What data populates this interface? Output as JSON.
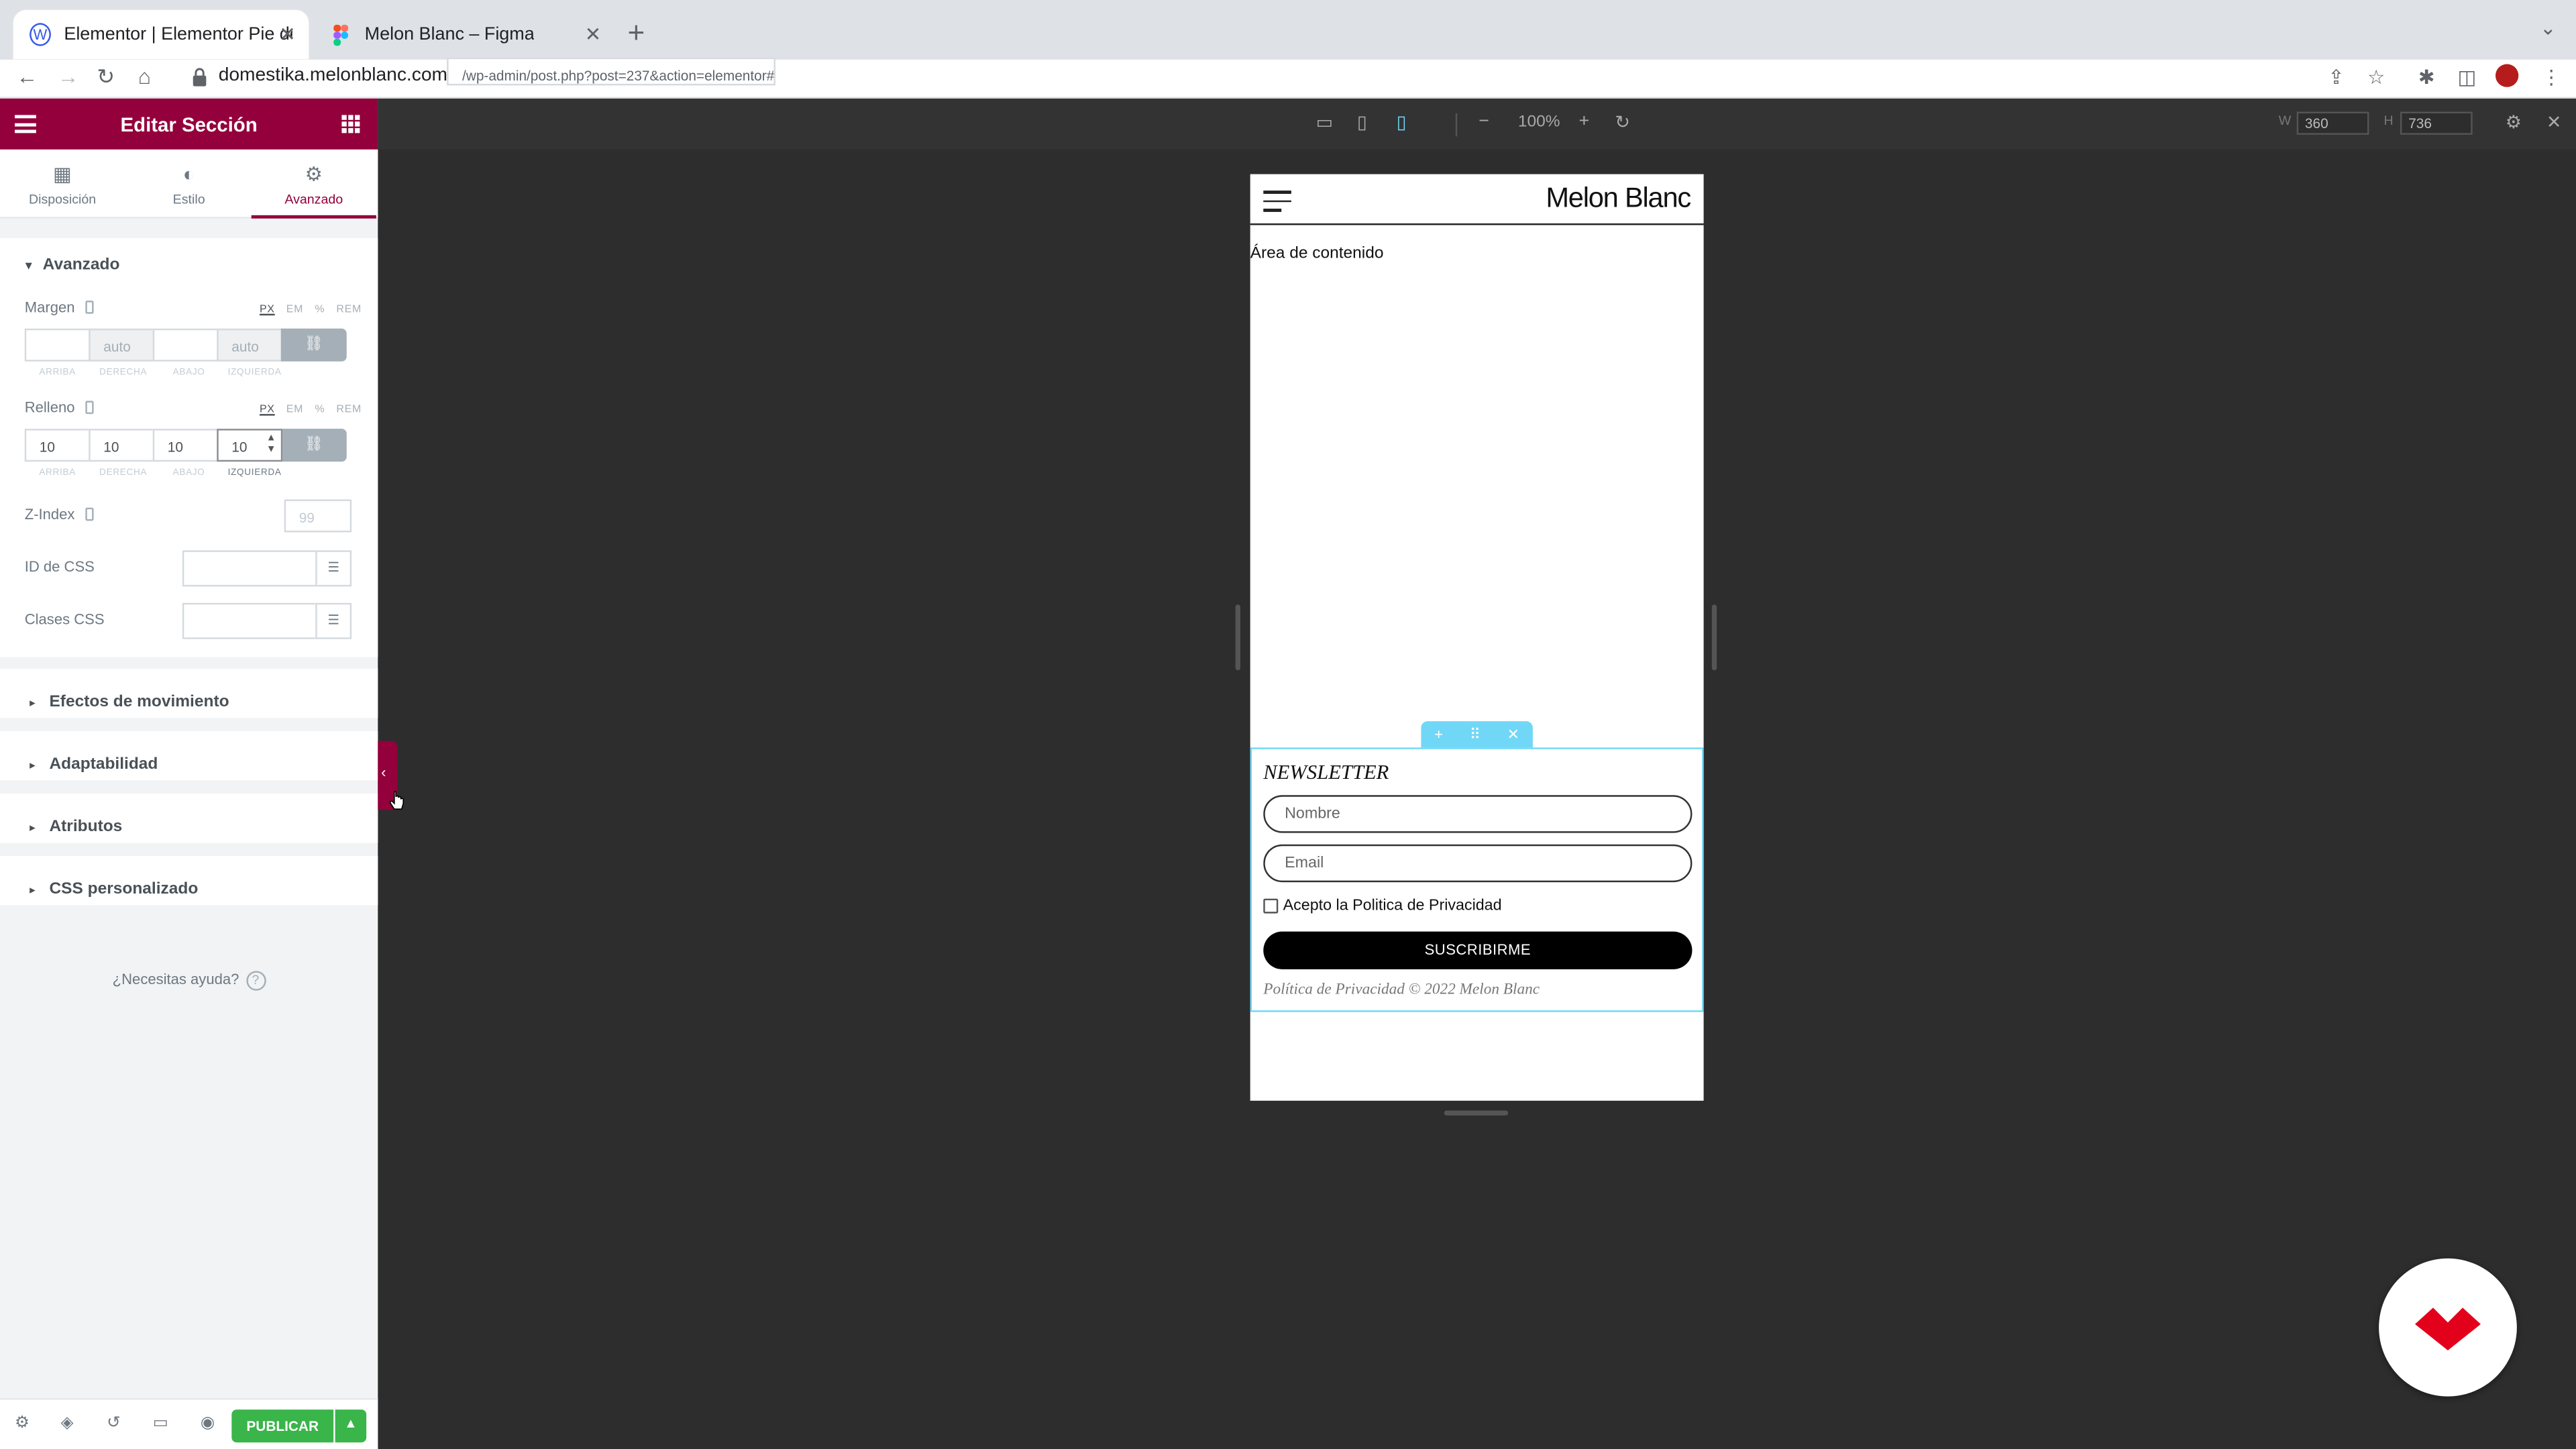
{
  "browser": {
    "tabs": [
      {
        "title": "Elementor | Elementor Pie de p",
        "active": true,
        "favicon": "wordpress-icon"
      },
      {
        "title": "Melon Blanc – Figma",
        "active": false,
        "favicon": "figma-icon"
      }
    ],
    "url_host": "domestika.melonblanc.com",
    "url_path": "/wp-admin/post.php?post=237&action=elementor#"
  },
  "panel": {
    "title": "Editar Sección",
    "tabs": [
      {
        "label": "Disposición",
        "icon": "layout-icon"
      },
      {
        "label": "Estilo",
        "icon": "style-icon"
      },
      {
        "label": "Avanzado",
        "icon": "gear-icon"
      }
    ],
    "active_tab": "Avanzado",
    "section_title": "Avanzado",
    "units": [
      "PX",
      "EM",
      "%",
      "REM"
    ],
    "margin": {
      "label": "Margen",
      "values": [
        "",
        "",
        "",
        ""
      ],
      "placeholders": [
        "",
        "auto",
        "",
        "auto"
      ]
    },
    "padding": {
      "label": "Relleno",
      "values": [
        "10",
        "10",
        "10",
        "10"
      ]
    },
    "side_labels": [
      "ARRIBA",
      "DERECHA",
      "ABAJO",
      "IZQUIERDA"
    ],
    "zindex": {
      "label": "Z-Index",
      "placeholder": "99"
    },
    "css_id_label": "ID de CSS",
    "css_classes_label": "Clases CSS",
    "collapsed_sections": [
      "Efectos de movimiento",
      "Adaptabilidad",
      "Atributos",
      "CSS personalizado"
    ],
    "help_text": "¿Necesitas ayuda?",
    "publish_label": "PUBLICAR"
  },
  "canvas": {
    "zoom": "100%",
    "width_label": "W",
    "width_value": "360",
    "height_label": "H",
    "height_value": "736"
  },
  "preview": {
    "brand": "Melon Blanc",
    "content_area": "Área de contenido",
    "newsletter_title": "NEWSLETTER",
    "name_placeholder": "Nombre",
    "email_placeholder": "Email",
    "checkbox_label": "Acepto la Politica de Privacidad",
    "subscribe_label": "SUSCRIBIRME",
    "footer_text": "Política de Privacidad © 2022 Melon Blanc"
  },
  "colors": {
    "elementor_brand": "#93003c",
    "publish_green": "#39b54a",
    "section_outline": "#71d7f7",
    "domestika_red": "#e3001b"
  }
}
